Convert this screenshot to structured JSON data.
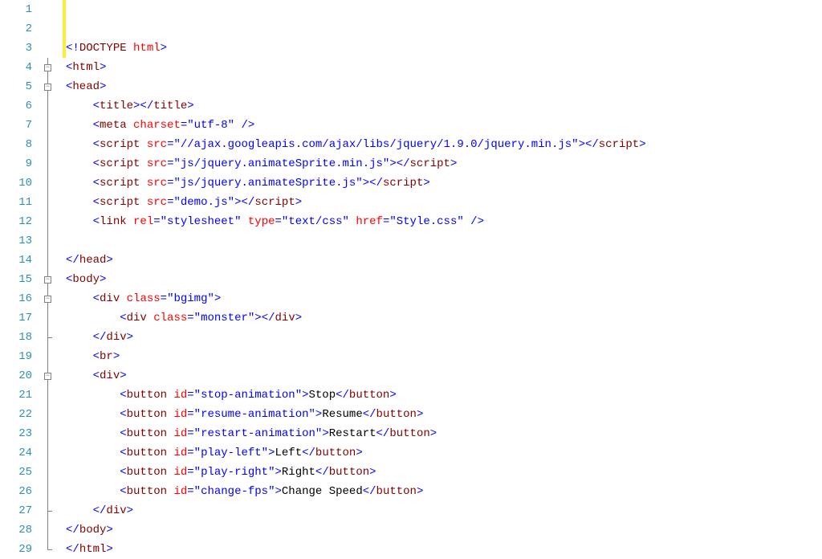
{
  "lines": [
    {
      "num": "1",
      "fold": null,
      "indent": 0,
      "tokens": []
    },
    {
      "num": "2",
      "fold": null,
      "indent": 0,
      "tokens": []
    },
    {
      "num": "3",
      "fold": null,
      "indent": 0,
      "tokens": [
        {
          "cls": "tag",
          "t": "<!"
        },
        {
          "cls": "tagname",
          "t": "DOCTYPE"
        },
        {
          "cls": "text",
          "t": " "
        },
        {
          "cls": "attr",
          "t": "html"
        },
        {
          "cls": "tag",
          "t": ">"
        }
      ]
    },
    {
      "num": "4",
      "fold": "minus",
      "indent": 0,
      "tokens": [
        {
          "cls": "tag",
          "t": "<"
        },
        {
          "cls": "tagname",
          "t": "html"
        },
        {
          "cls": "tag",
          "t": ">"
        }
      ]
    },
    {
      "num": "5",
      "fold": "minus",
      "indent": 0,
      "tokens": [
        {
          "cls": "tag",
          "t": "<"
        },
        {
          "cls": "tagname",
          "t": "head"
        },
        {
          "cls": "tag",
          "t": ">"
        }
      ]
    },
    {
      "num": "6",
      "fold": "pipe",
      "indent": 1,
      "tokens": [
        {
          "cls": "tag",
          "t": "<"
        },
        {
          "cls": "tagname",
          "t": "title"
        },
        {
          "cls": "tag",
          "t": "></"
        },
        {
          "cls": "tagname",
          "t": "title"
        },
        {
          "cls": "tag",
          "t": ">"
        }
      ]
    },
    {
      "num": "7",
      "fold": "pipe",
      "indent": 1,
      "tokens": [
        {
          "cls": "tag",
          "t": "<"
        },
        {
          "cls": "tagname",
          "t": "meta"
        },
        {
          "cls": "text",
          "t": " "
        },
        {
          "cls": "attr",
          "t": "charset"
        },
        {
          "cls": "tag",
          "t": "="
        },
        {
          "cls": "string",
          "t": "\"utf-8\""
        },
        {
          "cls": "text",
          "t": " "
        },
        {
          "cls": "tag",
          "t": "/>"
        }
      ]
    },
    {
      "num": "8",
      "fold": "pipe",
      "indent": 1,
      "tokens": [
        {
          "cls": "tag",
          "t": "<"
        },
        {
          "cls": "tagname",
          "t": "script"
        },
        {
          "cls": "text",
          "t": " "
        },
        {
          "cls": "attr",
          "t": "src"
        },
        {
          "cls": "tag",
          "t": "="
        },
        {
          "cls": "string",
          "t": "\"//ajax.googleapis.com/ajax/libs/jquery/1.9.0/jquery.min.js\""
        },
        {
          "cls": "tag",
          "t": "></"
        },
        {
          "cls": "tagname",
          "t": "script"
        },
        {
          "cls": "tag",
          "t": ">"
        }
      ]
    },
    {
      "num": "9",
      "fold": "pipe",
      "indent": 1,
      "tokens": [
        {
          "cls": "tag",
          "t": "<"
        },
        {
          "cls": "tagname",
          "t": "script"
        },
        {
          "cls": "text",
          "t": " "
        },
        {
          "cls": "attr",
          "t": "src"
        },
        {
          "cls": "tag",
          "t": "="
        },
        {
          "cls": "string",
          "t": "\"js/jquery.animateSprite.min.js\""
        },
        {
          "cls": "tag",
          "t": "></"
        },
        {
          "cls": "tagname",
          "t": "script"
        },
        {
          "cls": "tag",
          "t": ">"
        }
      ]
    },
    {
      "num": "10",
      "fold": "pipe",
      "indent": 1,
      "tokens": [
        {
          "cls": "tag",
          "t": "<"
        },
        {
          "cls": "tagname",
          "t": "script"
        },
        {
          "cls": "text",
          "t": " "
        },
        {
          "cls": "attr",
          "t": "src"
        },
        {
          "cls": "tag",
          "t": "="
        },
        {
          "cls": "string",
          "t": "\"js/jquery.animateSprite.js\""
        },
        {
          "cls": "tag",
          "t": "></"
        },
        {
          "cls": "tagname",
          "t": "script"
        },
        {
          "cls": "tag",
          "t": ">"
        }
      ]
    },
    {
      "num": "11",
      "fold": "pipe",
      "indent": 1,
      "tokens": [
        {
          "cls": "tag",
          "t": "<"
        },
        {
          "cls": "tagname",
          "t": "script"
        },
        {
          "cls": "text",
          "t": " "
        },
        {
          "cls": "attr",
          "t": "src"
        },
        {
          "cls": "tag",
          "t": "="
        },
        {
          "cls": "string",
          "t": "\"demo.js\""
        },
        {
          "cls": "tag",
          "t": "></"
        },
        {
          "cls": "tagname",
          "t": "script"
        },
        {
          "cls": "tag",
          "t": ">"
        }
      ]
    },
    {
      "num": "12",
      "fold": "pipe",
      "indent": 1,
      "tokens": [
        {
          "cls": "tag",
          "t": "<"
        },
        {
          "cls": "tagname",
          "t": "link"
        },
        {
          "cls": "text",
          "t": " "
        },
        {
          "cls": "attr",
          "t": "rel"
        },
        {
          "cls": "tag",
          "t": "="
        },
        {
          "cls": "string",
          "t": "\"stylesheet\""
        },
        {
          "cls": "text",
          "t": " "
        },
        {
          "cls": "attr",
          "t": "type"
        },
        {
          "cls": "tag",
          "t": "="
        },
        {
          "cls": "string",
          "t": "\"text/css\""
        },
        {
          "cls": "text",
          "t": " "
        },
        {
          "cls": "attr",
          "t": "href"
        },
        {
          "cls": "tag",
          "t": "="
        },
        {
          "cls": "string",
          "t": "\"Style.css\""
        },
        {
          "cls": "text",
          "t": " "
        },
        {
          "cls": "tag",
          "t": "/>"
        }
      ]
    },
    {
      "num": "13",
      "fold": "pipe",
      "indent": 0,
      "tokens": []
    },
    {
      "num": "14",
      "fold": "pipe",
      "indent": 0,
      "tokens": [
        {
          "cls": "tag",
          "t": "</"
        },
        {
          "cls": "tagname",
          "t": "head"
        },
        {
          "cls": "tag",
          "t": ">"
        }
      ]
    },
    {
      "num": "15",
      "fold": "minus",
      "indent": 0,
      "tokens": [
        {
          "cls": "tag",
          "t": "<"
        },
        {
          "cls": "tagname",
          "t": "body"
        },
        {
          "cls": "tag",
          "t": ">"
        }
      ]
    },
    {
      "num": "16",
      "fold": "minus",
      "indent": 1,
      "tokens": [
        {
          "cls": "tag",
          "t": "<"
        },
        {
          "cls": "tagname",
          "t": "div"
        },
        {
          "cls": "text",
          "t": " "
        },
        {
          "cls": "attr",
          "t": "class"
        },
        {
          "cls": "tag",
          "t": "="
        },
        {
          "cls": "string",
          "t": "\"bgimg\""
        },
        {
          "cls": "tag",
          "t": ">"
        }
      ]
    },
    {
      "num": "17",
      "fold": "pipe",
      "indent": 2,
      "tokens": [
        {
          "cls": "tag",
          "t": "<"
        },
        {
          "cls": "tagname",
          "t": "div"
        },
        {
          "cls": "text",
          "t": " "
        },
        {
          "cls": "attr",
          "t": "class"
        },
        {
          "cls": "tag",
          "t": "="
        },
        {
          "cls": "string",
          "t": "\"monster\""
        },
        {
          "cls": "tag",
          "t": "></"
        },
        {
          "cls": "tagname",
          "t": "div"
        },
        {
          "cls": "tag",
          "t": ">"
        }
      ]
    },
    {
      "num": "18",
      "fold": "corner",
      "indent": 1,
      "tokens": [
        {
          "cls": "tag",
          "t": "</"
        },
        {
          "cls": "tagname",
          "t": "div"
        },
        {
          "cls": "tag",
          "t": ">"
        }
      ]
    },
    {
      "num": "19",
      "fold": "pipe",
      "indent": 1,
      "tokens": [
        {
          "cls": "tag",
          "t": "<"
        },
        {
          "cls": "tagname",
          "t": "br"
        },
        {
          "cls": "tag",
          "t": ">"
        }
      ]
    },
    {
      "num": "20",
      "fold": "minus",
      "indent": 1,
      "tokens": [
        {
          "cls": "tag",
          "t": "<"
        },
        {
          "cls": "tagname",
          "t": "div"
        },
        {
          "cls": "tag",
          "t": ">"
        }
      ]
    },
    {
      "num": "21",
      "fold": "pipe",
      "indent": 2,
      "tokens": [
        {
          "cls": "tag",
          "t": "<"
        },
        {
          "cls": "tagname",
          "t": "button"
        },
        {
          "cls": "text",
          "t": " "
        },
        {
          "cls": "attr",
          "t": "id"
        },
        {
          "cls": "tag",
          "t": "="
        },
        {
          "cls": "string",
          "t": "\"stop-animation\""
        },
        {
          "cls": "tag",
          "t": ">"
        },
        {
          "cls": "text",
          "t": "Stop"
        },
        {
          "cls": "tag",
          "t": "</"
        },
        {
          "cls": "tagname",
          "t": "button"
        },
        {
          "cls": "tag",
          "t": ">"
        }
      ]
    },
    {
      "num": "22",
      "fold": "pipe",
      "indent": 2,
      "tokens": [
        {
          "cls": "tag",
          "t": "<"
        },
        {
          "cls": "tagname",
          "t": "button"
        },
        {
          "cls": "text",
          "t": " "
        },
        {
          "cls": "attr",
          "t": "id"
        },
        {
          "cls": "tag",
          "t": "="
        },
        {
          "cls": "string",
          "t": "\"resume-animation\""
        },
        {
          "cls": "tag",
          "t": ">"
        },
        {
          "cls": "text",
          "t": "Resume"
        },
        {
          "cls": "tag",
          "t": "</"
        },
        {
          "cls": "tagname",
          "t": "button"
        },
        {
          "cls": "tag",
          "t": ">"
        }
      ]
    },
    {
      "num": "23",
      "fold": "pipe",
      "indent": 2,
      "tokens": [
        {
          "cls": "tag",
          "t": "<"
        },
        {
          "cls": "tagname",
          "t": "button"
        },
        {
          "cls": "text",
          "t": " "
        },
        {
          "cls": "attr",
          "t": "id"
        },
        {
          "cls": "tag",
          "t": "="
        },
        {
          "cls": "string",
          "t": "\"restart-animation\""
        },
        {
          "cls": "tag",
          "t": ">"
        },
        {
          "cls": "text",
          "t": "Restart"
        },
        {
          "cls": "tag",
          "t": "</"
        },
        {
          "cls": "tagname",
          "t": "button"
        },
        {
          "cls": "tag",
          "t": ">"
        }
      ]
    },
    {
      "num": "24",
      "fold": "pipe",
      "indent": 2,
      "tokens": [
        {
          "cls": "tag",
          "t": "<"
        },
        {
          "cls": "tagname",
          "t": "button"
        },
        {
          "cls": "text",
          "t": " "
        },
        {
          "cls": "attr",
          "t": "id"
        },
        {
          "cls": "tag",
          "t": "="
        },
        {
          "cls": "string",
          "t": "\"play-left\""
        },
        {
          "cls": "tag",
          "t": ">"
        },
        {
          "cls": "text",
          "t": "Left"
        },
        {
          "cls": "tag",
          "t": "</"
        },
        {
          "cls": "tagname",
          "t": "button"
        },
        {
          "cls": "tag",
          "t": ">"
        }
      ]
    },
    {
      "num": "25",
      "fold": "pipe",
      "indent": 2,
      "tokens": [
        {
          "cls": "tag",
          "t": "<"
        },
        {
          "cls": "tagname",
          "t": "button"
        },
        {
          "cls": "text",
          "t": " "
        },
        {
          "cls": "attr",
          "t": "id"
        },
        {
          "cls": "tag",
          "t": "="
        },
        {
          "cls": "string",
          "t": "\"play-right\""
        },
        {
          "cls": "tag",
          "t": ">"
        },
        {
          "cls": "text",
          "t": "Right"
        },
        {
          "cls": "tag",
          "t": "</"
        },
        {
          "cls": "tagname",
          "t": "button"
        },
        {
          "cls": "tag",
          "t": ">"
        }
      ]
    },
    {
      "num": "26",
      "fold": "pipe",
      "indent": 2,
      "tokens": [
        {
          "cls": "tag",
          "t": "<"
        },
        {
          "cls": "tagname",
          "t": "button"
        },
        {
          "cls": "text",
          "t": " "
        },
        {
          "cls": "attr",
          "t": "id"
        },
        {
          "cls": "tag",
          "t": "="
        },
        {
          "cls": "string",
          "t": "\"change-fps\""
        },
        {
          "cls": "tag",
          "t": ">"
        },
        {
          "cls": "text",
          "t": "Change Speed"
        },
        {
          "cls": "tag",
          "t": "</"
        },
        {
          "cls": "tagname",
          "t": "button"
        },
        {
          "cls": "tag",
          "t": ">"
        }
      ]
    },
    {
      "num": "27",
      "fold": "corner",
      "indent": 1,
      "tokens": [
        {
          "cls": "tag",
          "t": "</"
        },
        {
          "cls": "tagname",
          "t": "div"
        },
        {
          "cls": "tag",
          "t": ">"
        }
      ]
    },
    {
      "num": "28",
      "fold": "pipe",
      "indent": 0,
      "tokens": [
        {
          "cls": "tag",
          "t": "</"
        },
        {
          "cls": "tagname",
          "t": "body"
        },
        {
          "cls": "tag",
          "t": ">"
        }
      ]
    },
    {
      "num": "29",
      "fold": "corner",
      "indent": 0,
      "tokens": [
        {
          "cls": "tag",
          "t": "</"
        },
        {
          "cls": "tagname",
          "t": "html"
        },
        {
          "cls": "tag",
          "t": ">"
        }
      ]
    }
  ],
  "highlight_lines": 3
}
